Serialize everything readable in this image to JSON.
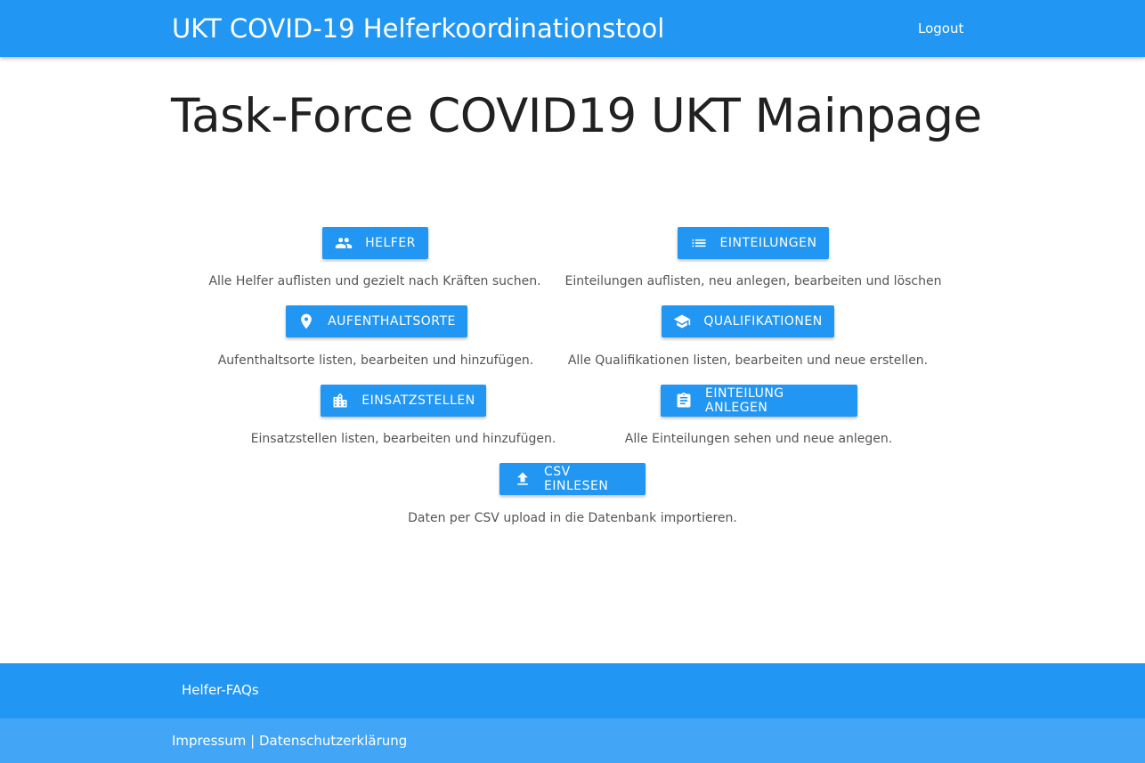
{
  "navbar": {
    "brand": "UKT COVID-19 Helferkoordinationstool",
    "logout": "Logout"
  },
  "main": {
    "title": "Task-Force COVID19 UKT Mainpage",
    "items": [
      {
        "label": "HELFER",
        "icon": "people-icon",
        "description": "Alle Helfer auflisten und gezielt nach Kräften suchen."
      },
      {
        "label": "EINTEILUNGEN",
        "icon": "list-icon",
        "description": "Einteilungen auflisten, neu anlegen, bearbeiten und löschen"
      },
      {
        "label": "AUFENTHALTSORTE",
        "icon": "place-icon",
        "description": "Aufenthaltsorte listen, bearbeiten und hinzufügen."
      },
      {
        "label": "QUALIFIKATIONEN",
        "icon": "school-icon",
        "description": "Alle Qualifikationen listen, bearbeiten und neue erstellen."
      },
      {
        "label": "EINSATZSTELLEN",
        "icon": "location-city-icon",
        "description": "Einsatzstellen listen, bearbeiten und hinzufügen."
      },
      {
        "label": "EINTEILUNG ANLEGEN",
        "icon": "assignment-icon",
        "description": "Alle Einteilungen sehen und neue anlegen."
      },
      {
        "label": "CSV EINLESEN",
        "icon": "upload-icon",
        "description": "Daten per CSV upload in die Datenbank importieren."
      }
    ]
  },
  "footer": {
    "faq": "Helfer-FAQs",
    "impressum": "Impressum",
    "separator": " | ",
    "privacy": "Datenschutzerklärung"
  },
  "colors": {
    "primary": "#2196f3",
    "footer_bottom": "#42a5f5"
  }
}
